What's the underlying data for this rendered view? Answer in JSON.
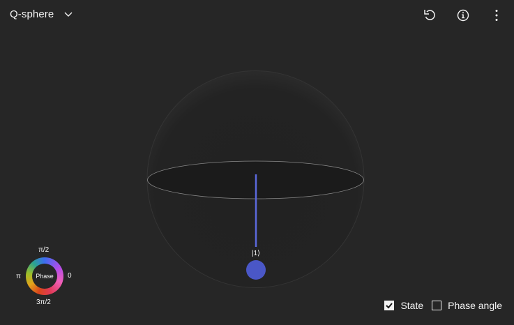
{
  "header": {
    "title": "Q-sphere",
    "icons": [
      "chevron-down-icon",
      "reset-icon",
      "info-icon",
      "overflow-menu-icon"
    ]
  },
  "sphere": {
    "state_label": "|1⟩",
    "state_color": "#4a57c7",
    "line_color": "#5b68db"
  },
  "legend": {
    "center": "Phase",
    "top": "π/2",
    "left": "π",
    "right": "0",
    "bottom": "3π/2"
  },
  "options": {
    "state_label": "State",
    "state_checked": true,
    "phase_label": "Phase angle",
    "phase_checked": false
  }
}
